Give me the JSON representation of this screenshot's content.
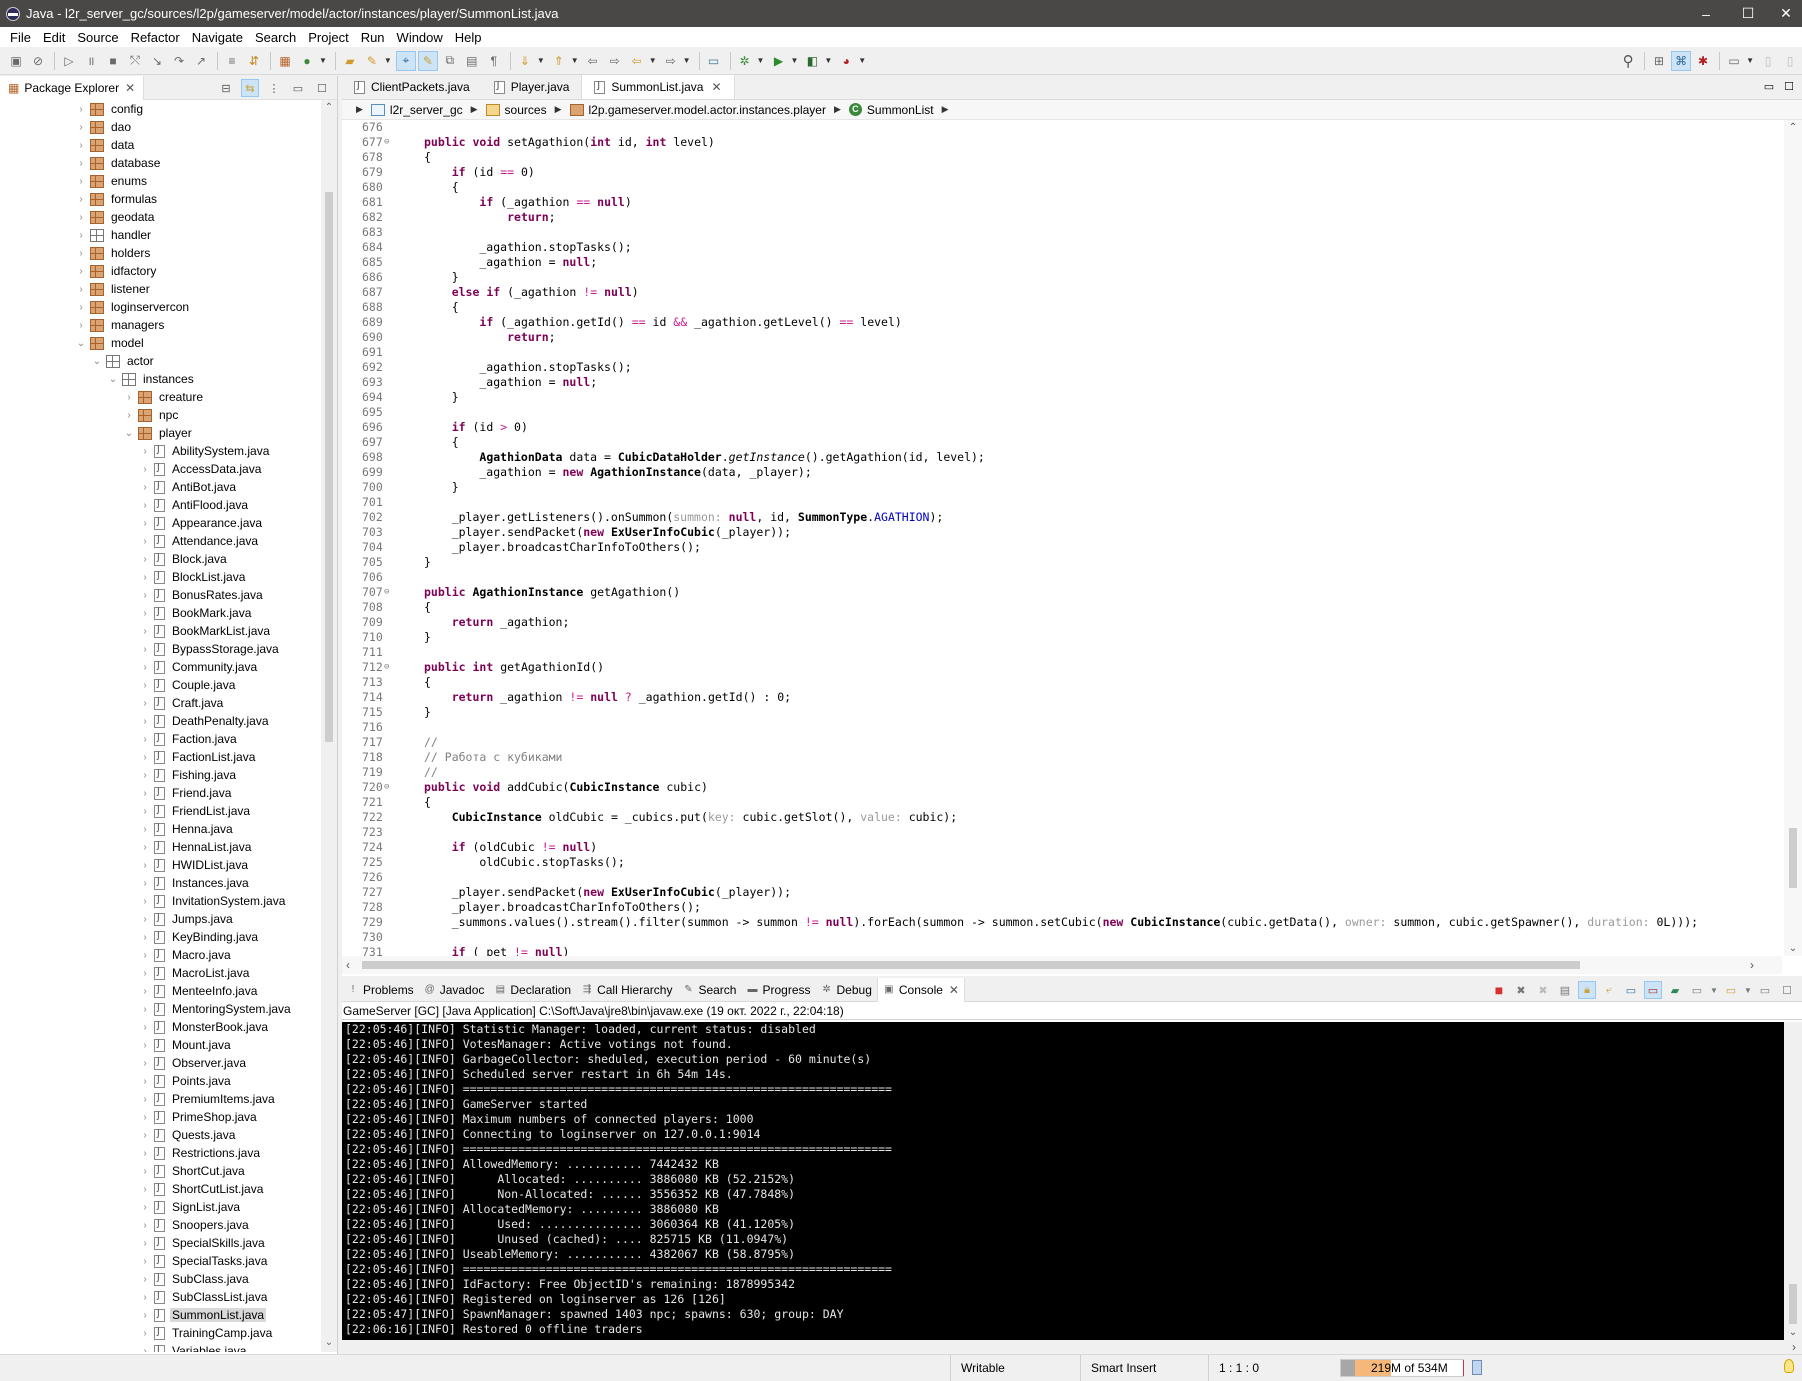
{
  "window": {
    "title": "Java - l2r_server_gc/sources/l2p/gameserver/model/actor/instances/player/SummonList.java",
    "controls": [
      "–",
      "☐",
      "✕"
    ]
  },
  "menu": [
    "File",
    "Edit",
    "Source",
    "Refactor",
    "Navigate",
    "Search",
    "Project",
    "Run",
    "Window",
    "Help"
  ],
  "package_explorer": {
    "title": "Package Explorer",
    "tree": [
      {
        "label": "config",
        "depth": 0,
        "type": "pkg",
        "expanded": false
      },
      {
        "label": "dao",
        "depth": 0,
        "type": "pkg",
        "expanded": false
      },
      {
        "label": "data",
        "depth": 0,
        "type": "pkg",
        "expanded": false
      },
      {
        "label": "database",
        "depth": 0,
        "type": "pkg",
        "expanded": false
      },
      {
        "label": "enums",
        "depth": 0,
        "type": "pkg",
        "expanded": false
      },
      {
        "label": "formulas",
        "depth": 0,
        "type": "pkg",
        "expanded": false
      },
      {
        "label": "geodata",
        "depth": 0,
        "type": "pkg",
        "expanded": false
      },
      {
        "label": "handler",
        "depth": 0,
        "type": "pkg-empty",
        "expanded": false
      },
      {
        "label": "holders",
        "depth": 0,
        "type": "pkg",
        "expanded": false
      },
      {
        "label": "idfactory",
        "depth": 0,
        "type": "pkg",
        "expanded": false
      },
      {
        "label": "listener",
        "depth": 0,
        "type": "pkg",
        "expanded": false
      },
      {
        "label": "loginservercon",
        "depth": 0,
        "type": "pkg",
        "expanded": false
      },
      {
        "label": "managers",
        "depth": 0,
        "type": "pkg",
        "expanded": false
      },
      {
        "label": "model",
        "depth": 0,
        "type": "pkg",
        "expanded": true
      },
      {
        "label": "actor",
        "depth": 1,
        "type": "pkg-empty",
        "expanded": true
      },
      {
        "label": "instances",
        "depth": 2,
        "type": "pkg-empty",
        "expanded": true
      },
      {
        "label": "creature",
        "depth": 3,
        "type": "pkg",
        "expanded": false
      },
      {
        "label": "npc",
        "depth": 3,
        "type": "pkg",
        "expanded": false
      },
      {
        "label": "player",
        "depth": 3,
        "type": "pkg",
        "expanded": true
      },
      {
        "label": "AbilitySystem.java",
        "depth": 4,
        "type": "jfile"
      },
      {
        "label": "AccessData.java",
        "depth": 4,
        "type": "jfile"
      },
      {
        "label": "AntiBot.java",
        "depth": 4,
        "type": "jfile"
      },
      {
        "label": "AntiFlood.java",
        "depth": 4,
        "type": "jfile"
      },
      {
        "label": "Appearance.java",
        "depth": 4,
        "type": "jfile"
      },
      {
        "label": "Attendance.java",
        "depth": 4,
        "type": "jfile"
      },
      {
        "label": "Block.java",
        "depth": 4,
        "type": "jfile"
      },
      {
        "label": "BlockList.java",
        "depth": 4,
        "type": "jfile"
      },
      {
        "label": "BonusRates.java",
        "depth": 4,
        "type": "jfile"
      },
      {
        "label": "BookMark.java",
        "depth": 4,
        "type": "jfile"
      },
      {
        "label": "BookMarkList.java",
        "depth": 4,
        "type": "jfile"
      },
      {
        "label": "BypassStorage.java",
        "depth": 4,
        "type": "jfile"
      },
      {
        "label": "Community.java",
        "depth": 4,
        "type": "jfile"
      },
      {
        "label": "Couple.java",
        "depth": 4,
        "type": "jfile"
      },
      {
        "label": "Craft.java",
        "depth": 4,
        "type": "jfile"
      },
      {
        "label": "DeathPenalty.java",
        "depth": 4,
        "type": "jfile"
      },
      {
        "label": "Faction.java",
        "depth": 4,
        "type": "jfile"
      },
      {
        "label": "FactionList.java",
        "depth": 4,
        "type": "jfile"
      },
      {
        "label": "Fishing.java",
        "depth": 4,
        "type": "jfile"
      },
      {
        "label": "Friend.java",
        "depth": 4,
        "type": "jfile"
      },
      {
        "label": "FriendList.java",
        "depth": 4,
        "type": "jfile"
      },
      {
        "label": "Henna.java",
        "depth": 4,
        "type": "jfile"
      },
      {
        "label": "HennaList.java",
        "depth": 4,
        "type": "jfile"
      },
      {
        "label": "HWIDList.java",
        "depth": 4,
        "type": "jfile"
      },
      {
        "label": "Instances.java",
        "depth": 4,
        "type": "jfile"
      },
      {
        "label": "InvitationSystem.java",
        "depth": 4,
        "type": "jfile"
      },
      {
        "label": "Jumps.java",
        "depth": 4,
        "type": "jfile"
      },
      {
        "label": "KeyBinding.java",
        "depth": 4,
        "type": "jfile"
      },
      {
        "label": "Macro.java",
        "depth": 4,
        "type": "jfile"
      },
      {
        "label": "MacroList.java",
        "depth": 4,
        "type": "jfile"
      },
      {
        "label": "MenteeInfo.java",
        "depth": 4,
        "type": "jfile"
      },
      {
        "label": "MentoringSystem.java",
        "depth": 4,
        "type": "jfile"
      },
      {
        "label": "MonsterBook.java",
        "depth": 4,
        "type": "jfile"
      },
      {
        "label": "Mount.java",
        "depth": 4,
        "type": "jfile"
      },
      {
        "label": "Observer.java",
        "depth": 4,
        "type": "jfile"
      },
      {
        "label": "Points.java",
        "depth": 4,
        "type": "jfile"
      },
      {
        "label": "PremiumItems.java",
        "depth": 4,
        "type": "jfile"
      },
      {
        "label": "PrimeShop.java",
        "depth": 4,
        "type": "jfile"
      },
      {
        "label": "Quests.java",
        "depth": 4,
        "type": "jfile"
      },
      {
        "label": "Restrictions.java",
        "depth": 4,
        "type": "jfile"
      },
      {
        "label": "ShortCut.java",
        "depth": 4,
        "type": "jfile"
      },
      {
        "label": "ShortCutList.java",
        "depth": 4,
        "type": "jfile"
      },
      {
        "label": "SignList.java",
        "depth": 4,
        "type": "jfile"
      },
      {
        "label": "Snoopers.java",
        "depth": 4,
        "type": "jfile"
      },
      {
        "label": "SpecialSkills.java",
        "depth": 4,
        "type": "jfile"
      },
      {
        "label": "SpecialTasks.java",
        "depth": 4,
        "type": "jfile"
      },
      {
        "label": "SubClass.java",
        "depth": 4,
        "type": "jfile"
      },
      {
        "label": "SubClassList.java",
        "depth": 4,
        "type": "jfile"
      },
      {
        "label": "SummonList.java",
        "depth": 4,
        "type": "jfile",
        "selected": true
      },
      {
        "label": "TrainingCamp.java",
        "depth": 4,
        "type": "jfile"
      },
      {
        "label": "Variables.java",
        "depth": 4,
        "type": "jfile"
      }
    ]
  },
  "editor": {
    "tabs": [
      {
        "label": "ClientPackets.java",
        "active": false
      },
      {
        "label": "Player.java",
        "active": false
      },
      {
        "label": "SummonList.java",
        "active": true
      }
    ],
    "breadcrumb": [
      {
        "label": "l2r_server_gc",
        "icon": "proj"
      },
      {
        "label": "sources",
        "icon": "src"
      },
      {
        "label": "l2p.gameserver.model.actor.instances.player",
        "icon": "pk"
      },
      {
        "label": "SummonList",
        "icon": "cls"
      }
    ],
    "lines": [
      {
        "n": "676",
        "code": ""
      },
      {
        "n": "677",
        "fold": true,
        "code": "<k>public</k> <k>void</k> setAgathion(<k>int</k> id, <k>int</k> level)"
      },
      {
        "n": "678",
        "code": "{"
      },
      {
        "n": "679",
        "code": "    <k>if</k> (id <o>==</o> 0)"
      },
      {
        "n": "680",
        "code": "    {"
      },
      {
        "n": "681",
        "code": "        <k>if</k> (_agathion <o>==</o> <k>null</k>)"
      },
      {
        "n": "682",
        "code": "            <k>return</k>;"
      },
      {
        "n": "683",
        "code": ""
      },
      {
        "n": "684",
        "code": "        _agathion.stopTasks();"
      },
      {
        "n": "685",
        "code": "        _agathion = <k>null</k>;"
      },
      {
        "n": "686",
        "code": "    }"
      },
      {
        "n": "687",
        "code": "    <k>else if</k> (_agathion <o>!=</o> <k>null</k>)"
      },
      {
        "n": "688",
        "code": "    {"
      },
      {
        "n": "689",
        "code": "        <k>if</k> (_agathion.getId() <o>==</o> id <o>&amp;&amp;</o> _agathion.getLevel() <o>==</o> level)"
      },
      {
        "n": "690",
        "code": "            <k>return</k>;"
      },
      {
        "n": "691",
        "code": ""
      },
      {
        "n": "692",
        "code": "        _agathion.stopTasks();"
      },
      {
        "n": "693",
        "code": "        _agathion = <k>null</k>;"
      },
      {
        "n": "694",
        "code": "    }"
      },
      {
        "n": "695",
        "code": ""
      },
      {
        "n": "696",
        "code": "    <k>if</k> (id <o>&gt;</o> 0)"
      },
      {
        "n": "697",
        "code": "    {"
      },
      {
        "n": "698",
        "code": "        <b>AgathionData</b> data = <b>CubicDataHolder</b>.<i>getInstance</i>().getAgathion(id, level);"
      },
      {
        "n": "699",
        "code": "        _agathion = <k>new</k> <b>AgathionInstance</b>(data, _player);"
      },
      {
        "n": "700",
        "code": "    }"
      },
      {
        "n": "701",
        "code": ""
      },
      {
        "n": "702",
        "code": "    _player.getListeners().onSummon(<h>summon:</h> <k>null</k>, id, <b>SummonType</b>.<f>AGATHION</f>);"
      },
      {
        "n": "703",
        "code": "    _player.sendPacket(<k>new</k> <b>ExUserInfoCubic</b>(_player));"
      },
      {
        "n": "704",
        "code": "    _player.broadcastCharInfoToOthers();"
      },
      {
        "n": "705",
        "code": "}"
      },
      {
        "n": "706",
        "code": ""
      },
      {
        "n": "707",
        "fold": true,
        "code": "<k>public</k> <b>AgathionInstance</b> getAgathion()"
      },
      {
        "n": "708",
        "code": "{"
      },
      {
        "n": "709",
        "code": "    <k>return</k> _agathion;"
      },
      {
        "n": "710",
        "code": "}"
      },
      {
        "n": "711",
        "code": ""
      },
      {
        "n": "712",
        "fold": true,
        "code": "<k>public</k> <k>int</k> getAgathionId()"
      },
      {
        "n": "713",
        "code": "{"
      },
      {
        "n": "714",
        "code": "    <k>return</k> _agathion <o>!=</o> <k>null</k> <o>?</o> _agathion.getId() : 0;"
      },
      {
        "n": "715",
        "code": "}"
      },
      {
        "n": "716",
        "code": ""
      },
      {
        "n": "717",
        "code": "<c>//</c>"
      },
      {
        "n": "718",
        "code": "<c>// Работа с кубиками</c>"
      },
      {
        "n": "719",
        "code": "<c>//</c>"
      },
      {
        "n": "720",
        "fold": true,
        "code": "<k>public</k> <k>void</k> addCubic(<b>CubicInstance</b> cubic)"
      },
      {
        "n": "721",
        "code": "{"
      },
      {
        "n": "722",
        "code": "    <b>CubicInstance</b> oldCubic = _cubics.put(<h>key:</h> cubic.getSlot(), <h>value:</h> cubic);"
      },
      {
        "n": "723",
        "code": ""
      },
      {
        "n": "724",
        "code": "    <k>if</k> (oldCubic <o>!=</o> <k>null</k>)"
      },
      {
        "n": "725",
        "code": "        oldCubic.stopTasks();"
      },
      {
        "n": "726",
        "code": ""
      },
      {
        "n": "727",
        "code": "    _player.sendPacket(<k>new</k> <b>ExUserInfoCubic</b>(_player));"
      },
      {
        "n": "728",
        "code": "    _player.broadcastCharInfoToOthers();"
      },
      {
        "n": "729",
        "code": "    _summons.values().stream().filter(summon -&gt; summon <o>!=</o> <k>null</k>).forEach(summon -&gt; summon.setCubic(<k>new</k> <b>CubicInstance</b>(cubic.getData(), <h>owner:</h> summon, cubic.getSpawner(), <h>duration:</h> 0L)));"
      },
      {
        "n": "730",
        "code": ""
      },
      {
        "n": "731",
        "code": "    <k>if</k> (_pet <o>!=</o> <k>null</k>)"
      }
    ]
  },
  "console": {
    "tabs": [
      {
        "label": "Problems",
        "icon": "problems-icon",
        "glyph": "!"
      },
      {
        "label": "Javadoc",
        "icon": "javadoc-icon",
        "glyph": "@"
      },
      {
        "label": "Declaration",
        "icon": "declaration-icon",
        "glyph": "▤"
      },
      {
        "label": "Call Hierarchy",
        "icon": "call-hierarchy-icon",
        "glyph": "⇶"
      },
      {
        "label": "Search",
        "icon": "search-icon",
        "glyph": "✎"
      },
      {
        "label": "Progress",
        "icon": "progress-icon",
        "glyph": "▬"
      },
      {
        "label": "Debug",
        "icon": "debug-icon",
        "glyph": "✲"
      },
      {
        "label": "Console",
        "icon": "console-icon",
        "glyph": "▣",
        "active": true
      }
    ],
    "description": "GameServer [GC] [Java Application] C:\\Soft\\Java\\jre8\\bin\\javaw.exe  (19 окт. 2022 г., 22:04:18)",
    "lines": [
      "[22:05:46][INFO] Statistic Manager: loaded, current status: disabled",
      "[22:05:46][INFO] VotesManager: Active votings not found.",
      "[22:05:46][INFO] GarbageCollector: sheduled, execution period - 60 minute(s)",
      "[22:05:46][INFO] Scheduled server restart in 6h 54m 14s.",
      "[22:05:46][INFO] ==============================================================",
      "[22:05:46][INFO] GameServer started",
      "[22:05:46][INFO] Maximum numbers of connected players: 1000",
      "[22:05:46][INFO] Connecting to loginserver on 127.0.0.1:9014",
      "[22:05:46][INFO] ==============================================================",
      "[22:05:46][INFO] AllowedMemory: ........... 7442432 KB",
      "[22:05:46][INFO]      Allocated: .......... 3886080 KB (52.2152%)",
      "[22:05:46][INFO]      Non-Allocated: ...... 3556352 KB (47.7848%)",
      "[22:05:46][INFO] AllocatedMemory: ......... 3886080 KB",
      "[22:05:46][INFO]      Used: ............... 3060364 KB (41.1205%)",
      "[22:05:46][INFO]      Unused (cached): .... 825715 KB (11.0947%)",
      "[22:05:46][INFO] UseableMemory: ........... 4382067 KB (58.8795%)",
      "[22:05:46][INFO] ==============================================================",
      "[22:05:46][INFO] IdFactory: Free ObjectID's remaining: 1878995342",
      "[22:05:46][INFO] Registered on loginserver as 126 [126]",
      "[22:05:47][INFO] SpawnManager: spawned 1403 npc; spawns: 630; group: DAY",
      "[22:06:16][INFO] Restored 0 offline traders"
    ]
  },
  "status": {
    "writable": "Writable",
    "insert_mode": "Smart Insert",
    "position": "1 : 1 : 0",
    "heap_label": "219M of 534M",
    "heap_used_fraction": 0.41
  }
}
